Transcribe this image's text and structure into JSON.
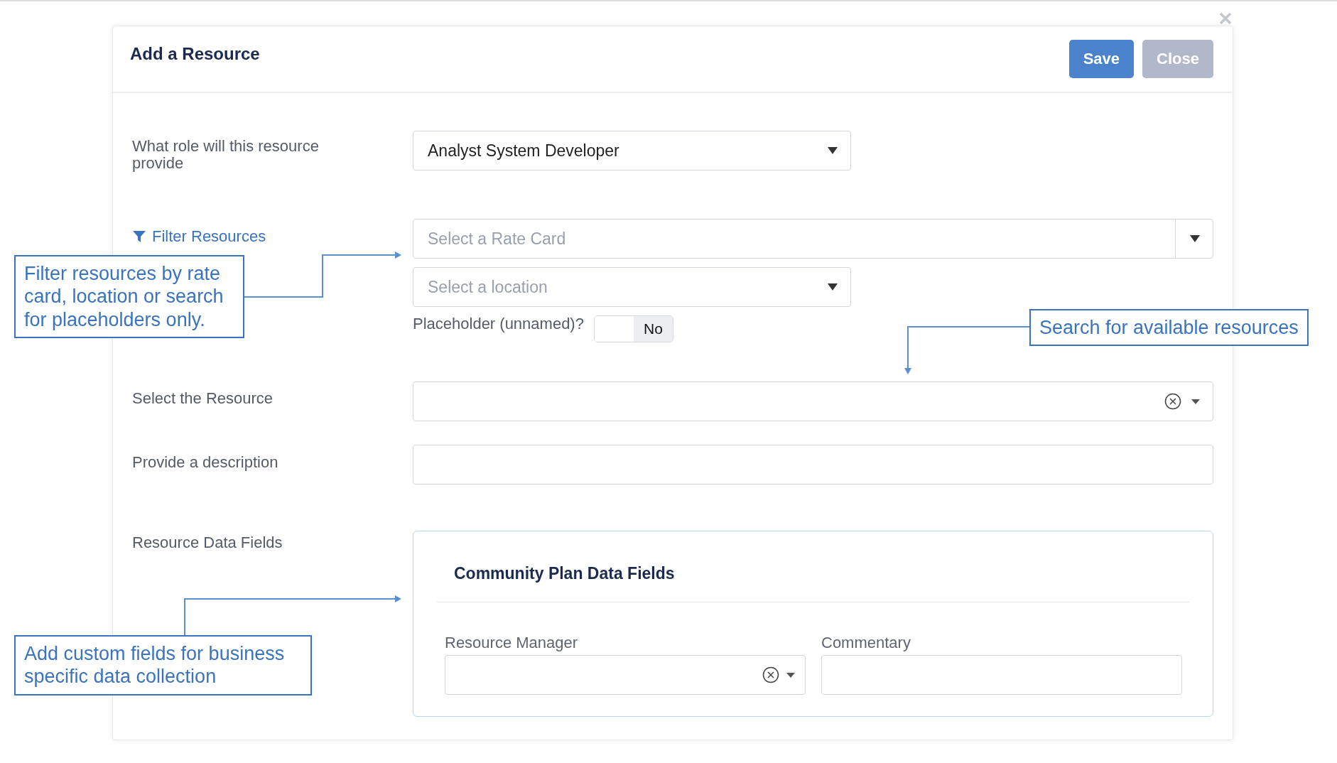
{
  "dialog": {
    "title": "Add a Resource",
    "buttons": [
      {
        "label": "Save",
        "kind": "primary",
        "disabled": false
      },
      {
        "label": "Close",
        "kind": "secondary",
        "disabled": true
      }
    ]
  },
  "form": {
    "role": {
      "label": "What role will this resource provide",
      "value": "Analyst System Developer"
    },
    "filter_link": "Filter Resources",
    "rate_card": {
      "placeholder": "Select a Rate Card"
    },
    "location": {
      "placeholder": "Select a location"
    },
    "placeholder_toggle": {
      "label": "Placeholder (unnamed)?",
      "state_text": "No",
      "on": false
    },
    "resource": {
      "label": "Select the Resource"
    },
    "description": {
      "label": "Provide a description"
    },
    "data_fields": {
      "label": "Resource Data Fields",
      "group_title": "Community Plan Data Fields",
      "fields": [
        {
          "label": "Resource Manager",
          "kind": "select"
        },
        {
          "label": "Commentary",
          "kind": "text"
        }
      ]
    }
  },
  "annotations": [
    {
      "text": "Filter resources by rate card, location or search for placeholders only.",
      "kind": "filter"
    },
    {
      "text": "Search for available resources",
      "kind": "search"
    },
    {
      "text": "Add custom fields for business specific data collection",
      "kind": "fields"
    }
  ]
}
